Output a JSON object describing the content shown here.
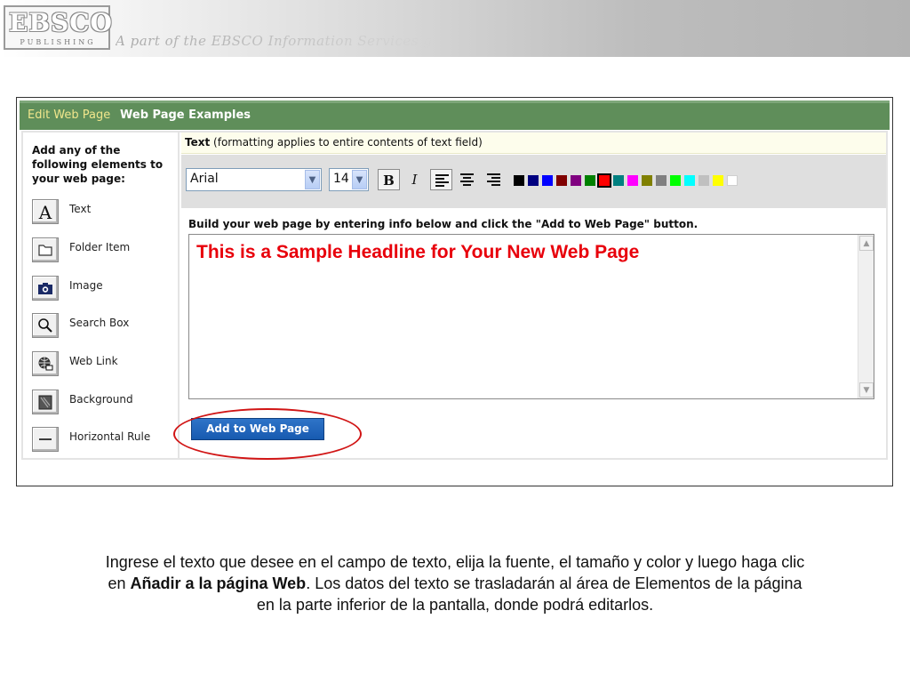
{
  "banner": {
    "logo_main": "EBSCO",
    "logo_sub": "PUBLISHING",
    "tagline": "A part of the EBSCO Information Services g"
  },
  "app": {
    "header": {
      "active_link": "Edit Web Page",
      "other_link": "Web Page Examples"
    },
    "sidebar": {
      "intro": "Add any of the following elements to your web page:",
      "items": [
        {
          "label": "Text",
          "icon": "letter-a-icon"
        },
        {
          "label": "Folder Item",
          "icon": "folder-icon"
        },
        {
          "label": "Image",
          "icon": "camera-icon"
        },
        {
          "label": "Search Box",
          "icon": "magnifier-icon"
        },
        {
          "label": "Web Link",
          "icon": "globe-link-icon"
        },
        {
          "label": "Background",
          "icon": "background-icon"
        },
        {
          "label": "Horizontal Rule",
          "icon": "horizontal-rule-icon"
        }
      ]
    },
    "text_section": {
      "title_bold": "Text",
      "title_note": "(formatting applies to entire contents of text field)",
      "font_value": "Arial",
      "size_value": "14",
      "bold_label": "B",
      "italic_label": "I",
      "colors": [
        "#000000",
        "#000080",
        "#0000ff",
        "#800000",
        "#800080",
        "#008000",
        "#ff0000",
        "#008080",
        "#ff00ff",
        "#808000",
        "#808080",
        "#00ff00",
        "#00ffff",
        "#c0c0c0",
        "#ffff00",
        "#ffffff"
      ],
      "selected_color": "#ff0000",
      "instruction": "Build your web page by entering info below and click the \"Add to Web Page\" button.",
      "textarea_value": "This is a Sample Headline for Your New Web Page",
      "add_button": "Add to Web Page"
    }
  },
  "caption": {
    "line1": "Ingrese el texto que desee en el campo de texto, elija la fuente, el tamaño y color y luego haga clic",
    "line2_pre": "en ",
    "line2_bold": "Añadir a la página Web",
    "line2_post": ". Los datos del texto se trasladarán al área de Elementos de la página",
    "line3": "en la parte inferior de la pantalla, donde podrá editarlos."
  }
}
